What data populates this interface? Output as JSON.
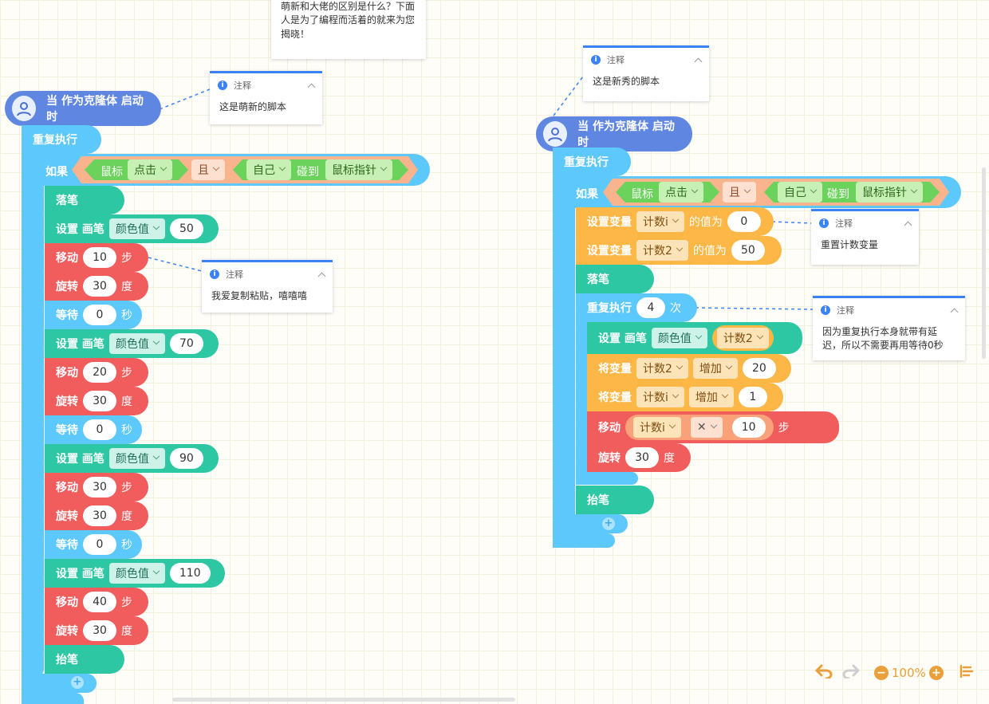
{
  "comments": {
    "top": "萌新和大佬的区别是什么？下面人是为了编程而活着的就来为您揭晓！",
    "header_label": "注释",
    "newbie": "这是萌新的脚本",
    "copy": "我爱复制粘贴，嘻嘻嘻",
    "pro": "这是新秀的脚本",
    "reset": "重置计数变量",
    "delay": "因为重复执行本身就带有延迟，所以不需要再用等待0秒"
  },
  "labels": {
    "hat": "当 作为克隆体 启动时",
    "forever": "重复执行",
    "if": "如果",
    "mouse": "鼠标",
    "click": "点击",
    "and": "且",
    "self": "自己",
    "touch": "碰到",
    "mouse_ptr": "鼠标指针",
    "pen_down": "落笔",
    "pen_up": "抬笔",
    "set_pen": "设置 画笔",
    "color": "颜色值",
    "move": "移动",
    "steps": "步",
    "turn": "旋转",
    "deg": "度",
    "wait": "等待",
    "sec": "秒",
    "set_var": "设置变量",
    "to_value": "的值为",
    "var_i": "计数i",
    "var_2": "计数2",
    "repeat": "重复执行",
    "times": "次",
    "change_var": "将变量",
    "increase": "增加",
    "times_op": "✕"
  },
  "left_script": {
    "groups": [
      {
        "color": "50",
        "move": "10",
        "turn": "30",
        "wait": "0"
      },
      {
        "color": "70",
        "move": "20",
        "turn": "30",
        "wait": "0"
      },
      {
        "color": "90",
        "move": "30",
        "turn": "30",
        "wait": "0"
      },
      {
        "color": "110",
        "move": "40",
        "turn": "30"
      }
    ]
  },
  "right_script": {
    "set_i": "0",
    "set_2": "50",
    "repeat": "4",
    "change_2": "20",
    "change_i": "1",
    "move_mul": "10",
    "turn": "30"
  },
  "toolbar": {
    "zoom": "100%"
  },
  "colors": {
    "control": "#5cc8fb",
    "pen": "#2dc7a3",
    "motion": "#f15c5c",
    "variables": "#fcb746",
    "sensing": "#6bd35b",
    "accent": "#e9a03b",
    "note_accent": "#3b82f6"
  }
}
